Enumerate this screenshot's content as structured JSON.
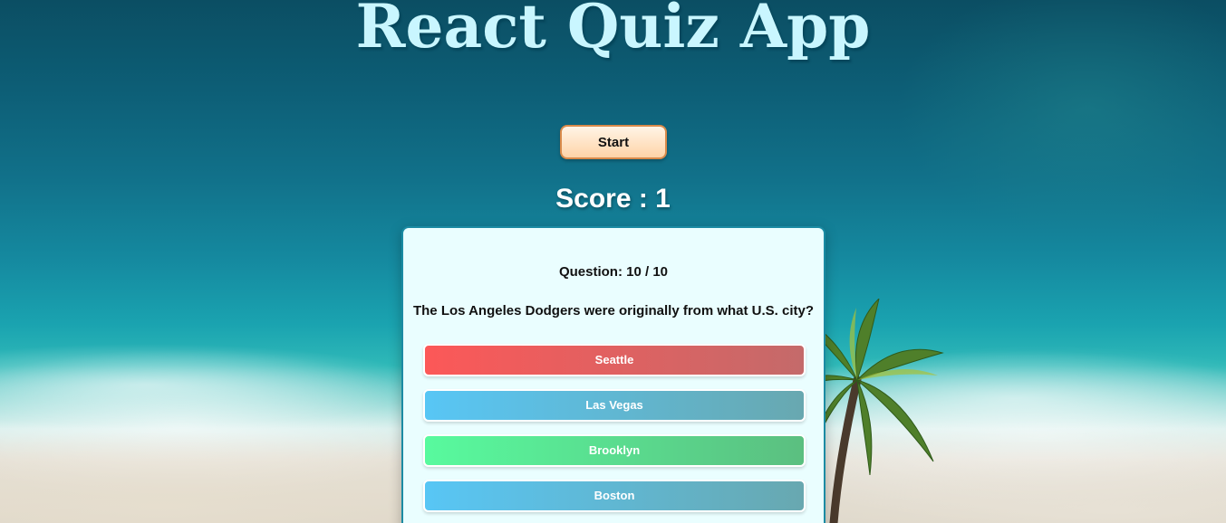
{
  "app": {
    "title": "React Quiz App"
  },
  "controls": {
    "start_label": "Start"
  },
  "score": {
    "text": "Score : 1"
  },
  "quiz": {
    "question_number": "Question: 10 / 10",
    "question": "The Los Angeles Dodgers were originally from what U.S. city?",
    "answers": [
      {
        "label": "Seattle",
        "color": "#fc5858"
      },
      {
        "label": "Las Vegas",
        "color": "#58c6f5"
      },
      {
        "label": "Brooklyn",
        "color": "#58fa9e"
      },
      {
        "label": "Boston",
        "color": "#58c6f5"
      }
    ]
  },
  "colors": {
    "title": "#c9f6ff",
    "card_background": "#eafeff",
    "card_border": "#1b8ba3",
    "start_button_border": "#d98a4a"
  }
}
